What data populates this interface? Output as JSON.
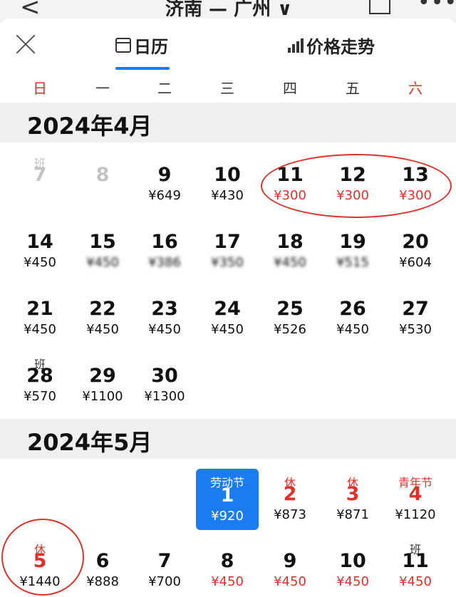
{
  "topbar": {
    "back": "<",
    "route": "济南 — 广州 ∨",
    "more": "•••"
  },
  "tabs": {
    "calendar": "日历",
    "trend": "价格走势"
  },
  "weekdays": [
    "日",
    "一",
    "二",
    "三",
    "四",
    "五",
    "六"
  ],
  "april": {
    "title": "2024年4月",
    "days": [
      {
        "d": "7",
        "p": "",
        "lab": "班",
        "state": "past"
      },
      {
        "d": "8",
        "p": "",
        "lab": "",
        "state": "past"
      },
      {
        "d": "9",
        "p": "¥649"
      },
      {
        "d": "10",
        "p": "¥430"
      },
      {
        "d": "11",
        "p": "¥300",
        "state": "red"
      },
      {
        "d": "12",
        "p": "¥300",
        "state": "red"
      },
      {
        "d": "13",
        "p": "¥300",
        "state": "red"
      },
      {
        "d": "14",
        "p": "¥450"
      },
      {
        "d": "15",
        "p": "¥450",
        "blur": true
      },
      {
        "d": "16",
        "p": "¥386",
        "blur": true
      },
      {
        "d": "17",
        "p": "¥350",
        "blur": true
      },
      {
        "d": "18",
        "p": "¥450",
        "blur": true
      },
      {
        "d": "19",
        "p": "¥515",
        "blur": true
      },
      {
        "d": "20",
        "p": "¥604"
      },
      {
        "d": "21",
        "p": "¥450"
      },
      {
        "d": "22",
        "p": "¥450"
      },
      {
        "d": "23",
        "p": "¥450"
      },
      {
        "d": "24",
        "p": "¥450"
      },
      {
        "d": "25",
        "p": "¥526"
      },
      {
        "d": "26",
        "p": "¥450"
      },
      {
        "d": "27",
        "p": "¥530"
      },
      {
        "d": "28",
        "p": "¥570",
        "lab": "班"
      },
      {
        "d": "29",
        "p": "¥1100"
      },
      {
        "d": "30",
        "p": "¥1300"
      }
    ]
  },
  "may": {
    "title": "2024年5月",
    "days": [
      {
        "d": "1",
        "p": "¥920",
        "lab": "劳动节",
        "state": "selected"
      },
      {
        "d": "2",
        "p": "¥873",
        "lab": "休",
        "state": "hol"
      },
      {
        "d": "3",
        "p": "¥871",
        "lab": "休",
        "state": "hol"
      },
      {
        "d": "4",
        "p": "¥1120",
        "lab": "青年节",
        "state": "hol"
      },
      {
        "d": "5",
        "p": "¥1440",
        "lab": "休",
        "state": "hol"
      },
      {
        "d": "6",
        "p": "¥888"
      },
      {
        "d": "7",
        "p": "¥700"
      },
      {
        "d": "8",
        "p": "¥450",
        "state": "red"
      },
      {
        "d": "9",
        "p": "¥450",
        "state": "red"
      },
      {
        "d": "10",
        "p": "¥450",
        "state": "red"
      },
      {
        "d": "11",
        "p": "¥450",
        "lab": "班",
        "state": "red"
      }
    ]
  },
  "colors": {
    "accent": "#1a7cf0",
    "red": "#e0302a"
  }
}
